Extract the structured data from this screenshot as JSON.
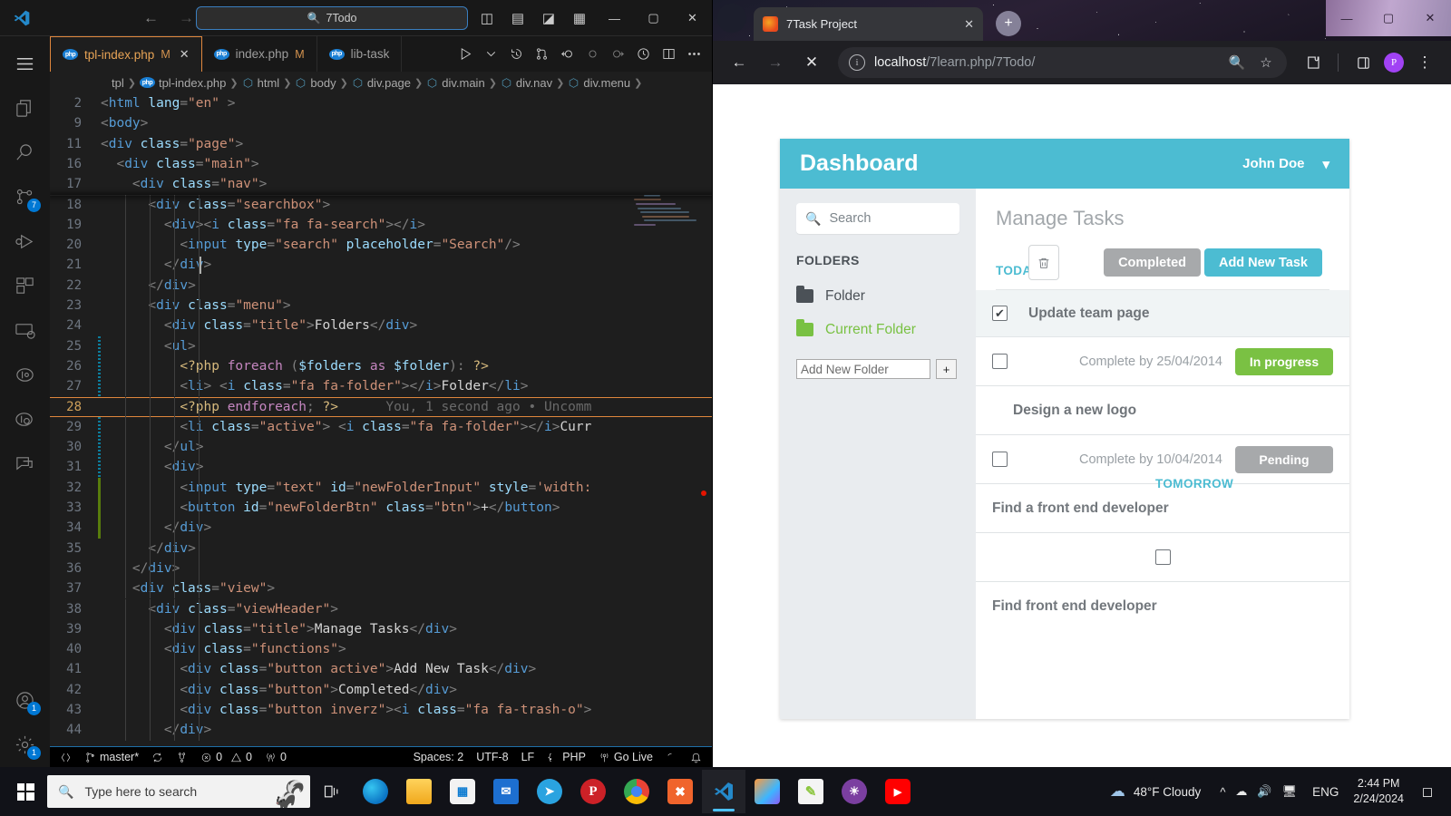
{
  "vscode": {
    "titlebar": {
      "search_text": "7Todo",
      "search_icon": "search-icon",
      "back_icon": "←",
      "forward_icon": "→",
      "layout_icons": [
        "panel-left-icon",
        "panel-bottom-icon",
        "panel-right-icon",
        "customize-layout-icon"
      ],
      "minimize": "—",
      "maximize": "▢",
      "close": "✕"
    },
    "activitybar": {
      "menu_icon": "hamburger-menu-icon",
      "items": [
        {
          "name": "explorer-icon",
          "badge": ""
        },
        {
          "name": "search-icon",
          "badge": ""
        },
        {
          "name": "source-control-icon",
          "badge": "7"
        },
        {
          "name": "run-debug-icon",
          "badge": ""
        },
        {
          "name": "extensions-icon",
          "badge": ""
        },
        {
          "name": "remote-explorer-icon",
          "badge": ""
        },
        {
          "name": "git-graph-icon",
          "badge": ""
        },
        {
          "name": "git-lens-icon",
          "badge": ""
        },
        {
          "name": "chat-icon",
          "badge": ""
        }
      ],
      "bottom_items": [
        {
          "name": "accounts-icon",
          "badge": "1"
        },
        {
          "name": "settings-gear-icon",
          "badge": "1"
        }
      ]
    },
    "tabs": [
      {
        "label": "tpl-index.php",
        "modified": "M",
        "active": true,
        "icon": "php-file-icon",
        "close": "✕"
      },
      {
        "label": "index.php",
        "modified": "M",
        "active": false,
        "icon": "php-file-icon",
        "close": ""
      },
      {
        "label": "lib-task",
        "modified": "",
        "active": false,
        "icon": "php-file-icon",
        "close": ""
      }
    ],
    "tab_actions": [
      "run-icon",
      "chevron-down-icon",
      "timeline-icon",
      "compare-icon",
      "go-back-icon",
      "circle-icon",
      "circle-arrow-icon",
      "clock-icon",
      "split-editor-icon",
      "more-actions-icon"
    ],
    "breadcrumb": [
      "tpl",
      "tpl-index.php",
      "html",
      "body",
      "div.page",
      "div.main",
      "div.nav",
      "div.menu"
    ],
    "code_lines": [
      {
        "num": "2",
        "sticky": true,
        "html": "<span class=\"t-punc\">&lt;</span><span class=\"t-tag\">html</span> <span class=\"t-attr\">lang</span><span class=\"t-punc\">=</span><span class=\"t-str\">\"en\"</span> <span class=\"t-punc\">&gt;</span>"
      },
      {
        "num": "9",
        "sticky": true,
        "html": "<span class=\"t-punc\">&lt;</span><span class=\"t-tag\">body</span><span class=\"t-punc\">&gt;</span>"
      },
      {
        "num": "11",
        "sticky": true,
        "html": "<span class=\"t-punc\">&lt;</span><span class=\"t-tag\">div</span> <span class=\"t-attr\">class</span><span class=\"t-punc\">=</span><span class=\"t-str\">\"page\"</span><span class=\"t-punc\">&gt;</span>"
      },
      {
        "num": "16",
        "sticky": true,
        "html": "  <span class=\"t-punc\">&lt;</span><span class=\"t-tag\">div</span> <span class=\"t-attr\">class</span><span class=\"t-punc\">=</span><span class=\"t-str\">\"main\"</span><span class=\"t-punc\">&gt;</span>"
      },
      {
        "num": "17",
        "sticky": true,
        "html": "    <span class=\"t-punc\">&lt;</span><span class=\"t-tag\">div</span> <span class=\"t-attr\">class</span><span class=\"t-punc\">=</span><span class=\"t-str\">\"nav\"</span><span class=\"t-punc\">&gt;</span>"
      },
      {
        "num": "18",
        "html": "      <span class=\"t-punc\">&lt;</span><span class=\"t-tag\">div</span> <span class=\"t-attr\">class</span><span class=\"t-punc\">=</span><span class=\"t-str\">\"searchbox\"</span><span class=\"t-punc\">&gt;</span>"
      },
      {
        "num": "19",
        "html": "        <span class=\"t-punc\">&lt;</span><span class=\"t-tag\">div</span><span class=\"t-punc\">&gt;&lt;</span><span class=\"t-tag\">i</span> <span class=\"t-attr\">class</span><span class=\"t-punc\">=</span><span class=\"t-str\">\"fa fa-search\"</span><span class=\"t-punc\">&gt;&lt;/</span><span class=\"t-tag\">i</span><span class=\"t-punc\">&gt;</span>"
      },
      {
        "num": "20",
        "html": "          <span class=\"t-punc\">&lt;</span><span class=\"t-tag\">input</span> <span class=\"t-attr\">type</span><span class=\"t-punc\">=</span><span class=\"t-str\">\"search\"</span> <span class=\"t-attr\">placeholder</span><span class=\"t-punc\">=</span><span class=\"t-str\">\"Search\"</span><span class=\"t-punc\">/&gt;</span>"
      },
      {
        "num": "21",
        "html": "        <span class=\"t-punc\">&lt;/</span><span class=\"t-tag\">div</span><span class=\"t-punc\">&gt;</span>"
      },
      {
        "num": "22",
        "html": "      <span class=\"t-punc\">&lt;/</span><span class=\"t-tag\">div</span><span class=\"t-punc\">&gt;</span>"
      },
      {
        "num": "23",
        "html": "      <span class=\"t-punc\">&lt;</span><span class=\"t-tag\">div</span> <span class=\"t-attr\">class</span><span class=\"t-punc\">=</span><span class=\"t-str\">\"menu\"</span><span class=\"t-punc\">&gt;</span>"
      },
      {
        "num": "24",
        "html": "        <span class=\"t-punc\">&lt;</span><span class=\"t-tag\">div</span> <span class=\"t-attr\">class</span><span class=\"t-punc\">=</span><span class=\"t-str\">\"title\"</span><span class=\"t-punc\">&gt;</span><span class=\"t-txt\">Folders</span><span class=\"t-punc\">&lt;/</span><span class=\"t-tag\">div</span><span class=\"t-punc\">&gt;</span>"
      },
      {
        "num": "25",
        "html": "        <span class=\"t-punc\">&lt;</span><span class=\"t-tag\">ul</span><span class=\"t-punc\">&gt;</span>"
      },
      {
        "num": "26",
        "html": "          <span class=\"t-dlm\">&lt;?php</span> <span class=\"t-kw\">foreach</span> <span class=\"t-punc\">(</span><span class=\"t-var\">$folders</span> <span class=\"t-kw\">as</span> <span class=\"t-var\">$folder</span><span class=\"t-punc\">):</span> <span class=\"t-dlm\">?&gt;</span>"
      },
      {
        "num": "27",
        "html": "          <span class=\"t-punc\">&lt;</span><span class=\"t-tag\">li</span><span class=\"t-punc\">&gt;</span> <span class=\"t-punc\">&lt;</span><span class=\"t-tag\">i</span> <span class=\"t-attr\">class</span><span class=\"t-punc\">=</span><span class=\"t-str\">\"fa fa-folder\"</span><span class=\"t-punc\">&gt;&lt;/</span><span class=\"t-tag\">i</span><span class=\"t-punc\">&gt;</span><span class=\"t-txt\">Folder</span><span class=\"t-punc\">&lt;/</span><span class=\"t-tag\">li</span><span class=\"t-punc\">&gt;</span>"
      },
      {
        "num": "28",
        "current": true,
        "html": "          <span class=\"t-dlm\">&lt;?php</span> <span class=\"t-kw\">endforeach</span><span class=\"t-punc\">;</span> <span class=\"t-dlm\">?&gt;</span>      <span class=\"t-blame\">You, 1 second ago • Uncomm</span>"
      },
      {
        "num": "29",
        "html": "          <span class=\"t-punc\">&lt;</span><span class=\"t-tag\">li</span> <span class=\"t-attr\">class</span><span class=\"t-punc\">=</span><span class=\"t-str\">\"active\"</span><span class=\"t-punc\">&gt;</span> <span class=\"t-punc\">&lt;</span><span class=\"t-tag\">i</span> <span class=\"t-attr\">class</span><span class=\"t-punc\">=</span><span class=\"t-str\">\"fa fa-folder\"</span><span class=\"t-punc\">&gt;&lt;/</span><span class=\"t-tag\">i</span><span class=\"t-punc\">&gt;</span><span class=\"t-txt\">Curr</span>"
      },
      {
        "num": "30",
        "html": "        <span class=\"t-punc\">&lt;/</span><span class=\"t-tag\">ul</span><span class=\"t-punc\">&gt;</span>"
      },
      {
        "num": "31",
        "html": "        <span class=\"t-punc\">&lt;</span><span class=\"t-tag\">div</span><span class=\"t-punc\">&gt;</span>"
      },
      {
        "num": "32",
        "html": "          <span class=\"t-punc\">&lt;</span><span class=\"t-tag\">input</span> <span class=\"t-attr\">type</span><span class=\"t-punc\">=</span><span class=\"t-str\">\"text\"</span> <span class=\"t-attr\">id</span><span class=\"t-punc\">=</span><span class=\"t-str\">\"newFolderInput\"</span> <span class=\"t-attr\">style</span><span class=\"t-punc\">=</span><span class=\"t-str\">'width:</span>"
      },
      {
        "num": "33",
        "html": "          <span class=\"t-punc\">&lt;</span><span class=\"t-tag\">button</span> <span class=\"t-attr\">id</span><span class=\"t-punc\">=</span><span class=\"t-str\">\"newFolderBtn\"</span> <span class=\"t-attr\">class</span><span class=\"t-punc\">=</span><span class=\"t-str\">\"btn\"</span><span class=\"t-punc\">&gt;</span><span class=\"t-txt\">+</span><span class=\"t-punc\">&lt;/</span><span class=\"t-tag\">button</span><span class=\"t-punc\">&gt;</span>"
      },
      {
        "num": "34",
        "html": "        <span class=\"t-punc\">&lt;/</span><span class=\"t-tag\">div</span><span class=\"t-punc\">&gt;</span>"
      },
      {
        "num": "35",
        "html": "      <span class=\"t-punc\">&lt;/</span><span class=\"t-tag\">div</span><span class=\"t-punc\">&gt;</span>"
      },
      {
        "num": "36",
        "html": "    <span class=\"t-punc\">&lt;/</span><span class=\"t-tag\">div</span><span class=\"t-punc\">&gt;</span>"
      },
      {
        "num": "37",
        "html": "    <span class=\"t-punc\">&lt;</span><span class=\"t-tag\">div</span> <span class=\"t-attr\">class</span><span class=\"t-punc\">=</span><span class=\"t-str\">\"view\"</span><span class=\"t-punc\">&gt;</span>"
      },
      {
        "num": "38",
        "html": "      <span class=\"t-punc\">&lt;</span><span class=\"t-tag\">div</span> <span class=\"t-attr\">class</span><span class=\"t-punc\">=</span><span class=\"t-str\">\"viewHeader\"</span><span class=\"t-punc\">&gt;</span>"
      },
      {
        "num": "39",
        "html": "        <span class=\"t-punc\">&lt;</span><span class=\"t-tag\">div</span> <span class=\"t-attr\">class</span><span class=\"t-punc\">=</span><span class=\"t-str\">\"title\"</span><span class=\"t-punc\">&gt;</span><span class=\"t-txt\">Manage Tasks</span><span class=\"t-punc\">&lt;/</span><span class=\"t-tag\">div</span><span class=\"t-punc\">&gt;</span>"
      },
      {
        "num": "40",
        "html": "        <span class=\"t-punc\">&lt;</span><span class=\"t-tag\">div</span> <span class=\"t-attr\">class</span><span class=\"t-punc\">=</span><span class=\"t-str\">\"functions\"</span><span class=\"t-punc\">&gt;</span>"
      },
      {
        "num": "41",
        "html": "          <span class=\"t-punc\">&lt;</span><span class=\"t-tag\">div</span> <span class=\"t-attr\">class</span><span class=\"t-punc\">=</span><span class=\"t-str\">\"button active\"</span><span class=\"t-punc\">&gt;</span><span class=\"t-txt\">Add New Task</span><span class=\"t-punc\">&lt;/</span><span class=\"t-tag\">div</span><span class=\"t-punc\">&gt;</span>"
      },
      {
        "num": "42",
        "html": "          <span class=\"t-punc\">&lt;</span><span class=\"t-tag\">div</span> <span class=\"t-attr\">class</span><span class=\"t-punc\">=</span><span class=\"t-str\">\"button\"</span><span class=\"t-punc\">&gt;</span><span class=\"t-txt\">Completed</span><span class=\"t-punc\">&lt;/</span><span class=\"t-tag\">div</span><span class=\"t-punc\">&gt;</span>"
      },
      {
        "num": "43",
        "html": "          <span class=\"t-punc\">&lt;</span><span class=\"t-tag\">div</span> <span class=\"t-attr\">class</span><span class=\"t-punc\">=</span><span class=\"t-str\">\"button inverz\"</span><span class=\"t-punc\">&gt;&lt;</span><span class=\"t-tag\">i</span> <span class=\"t-attr\">class</span><span class=\"t-punc\">=</span><span class=\"t-str\">\"fa fa-trash-o\"</span><span class=\"t-punc\">&gt;</span>"
      },
      {
        "num": "44",
        "html": "        <span class=\"t-punc\">&lt;/</span><span class=\"t-tag\">div</span><span class=\"t-punc\">&gt;</span>"
      }
    ],
    "statusbar": {
      "remote_icon": "remote-window-icon",
      "branch_icon": "git-branch-icon",
      "branch": "master*",
      "sync_icon": "sync-icon",
      "fork_icon": "git-fork-icon",
      "errors_icon": "error-icon",
      "errors": "0",
      "warnings_icon": "warning-icon",
      "warnings": "0",
      "ports_icon": "radio-tower-icon",
      "ports": "0",
      "spaces": "Spaces: 2",
      "encoding": "UTF-8",
      "eol": "LF",
      "language_icon": "braces-icon",
      "language": "PHP",
      "golive_icon": "broadcast-icon",
      "golive": "Go Live",
      "spinner_icon": "loading-spinner-icon",
      "bell_icon": "bell-icon"
    }
  },
  "browser": {
    "tab_chevron_icon": "chevron-down-icon",
    "tab": {
      "favicon": "site-favicon",
      "title": "7Task Project",
      "close_icon": "close-icon"
    },
    "new_tab_icon": "+",
    "window_controls": {
      "minimize": "—",
      "maximize": "▢",
      "close": "✕"
    },
    "toolbar": {
      "back_icon": "←",
      "forward_icon": "→",
      "stop_icon": "✕",
      "site_info_icon": "info-circle-icon",
      "url_host": "localhost",
      "url_path": "/7learn.php/7Todo/",
      "zoom_icon": "search-glass-icon",
      "bookmark_icon": "star-icon",
      "extensions_icon": "puzzle-icon",
      "sidepanel_icon": "side-panel-icon",
      "profile_initial": "P",
      "menu_icon": "three-dots-menu-icon"
    }
  },
  "app": {
    "header": {
      "title": "Dashboard",
      "user": "John Doe",
      "chevron_icon": "chevron-down-icon"
    },
    "nav": {
      "search_icon": "search-icon",
      "search_placeholder": "Search",
      "search_value": "",
      "menu_title": "FOLDERS",
      "folders": [
        {
          "label": "Folder",
          "active": false,
          "icon": "folder-icon"
        },
        {
          "label": "Current Folder",
          "active": true,
          "icon": "folder-icon"
        }
      ],
      "new_folder_placeholder": "Add New Folder",
      "new_folder_value": "",
      "new_folder_button": "+"
    },
    "view": {
      "title": "Manage Tasks",
      "buttons": {
        "add_new_task": "Add New Task",
        "completed": "Completed",
        "trash_icon": "trash-icon"
      },
      "day_today": "TODAY",
      "day_tomorrow": "TOMORROW",
      "tasks": [
        {
          "name": "Update team page",
          "checked": true,
          "check_icon": "checked-box-icon",
          "due": "",
          "status": "",
          "status_color": ""
        },
        {
          "name": "",
          "checked": false,
          "check_icon": "empty-box-icon",
          "due": "Complete by 25/04/2014",
          "status": "In progress",
          "status_color": "#7ac143"
        },
        {
          "name": "Design a new logo",
          "checked": null,
          "check_icon": "",
          "due": "",
          "status": "",
          "status_color": ""
        },
        {
          "name": "",
          "checked": false,
          "check_icon": "empty-box-icon",
          "due": "Complete by 10/04/2014",
          "status": "Pending",
          "status_color": "#a7a9ab"
        },
        {
          "name": "Find a front end developer",
          "checked": null,
          "check_icon": "",
          "due": "",
          "status": "",
          "status_color": ""
        },
        {
          "name": "",
          "checked": false,
          "check_icon": "empty-box-icon",
          "due": "",
          "status": "",
          "status_color": ""
        },
        {
          "name": "Find front end developer",
          "checked": null,
          "check_icon": "",
          "due": "",
          "status": "",
          "status_color": ""
        }
      ]
    }
  },
  "taskbar": {
    "start_icon": "windows-start-icon",
    "search_icon": "search-icon",
    "search_placeholder": "Type here to search",
    "mascot_icon": "monkey-icon",
    "taskview_icon": "task-view-icon",
    "pinned": [
      {
        "name": "edge-icon",
        "glyph": "e",
        "color": "#0f7dc2"
      },
      {
        "name": "file-explorer-icon",
        "glyph": "",
        "color": "#f5b81c"
      },
      {
        "name": "microsoft-store-icon",
        "glyph": "",
        "color": "#f2f2f2"
      },
      {
        "name": "mail-icon",
        "glyph": "",
        "color": "#1d6fd0"
      },
      {
        "name": "telegram-icon",
        "glyph": "",
        "color": "#2aa3e0"
      },
      {
        "name": "pinterest-icon",
        "glyph": "P",
        "color": "#cc2127"
      },
      {
        "name": "chrome-icon",
        "glyph": "",
        "color": "#ffffff"
      },
      {
        "name": "xampp-icon",
        "glyph": "",
        "color": "#f0642c"
      },
      {
        "name": "vscode-icon",
        "glyph": "",
        "color": "#2489ca"
      },
      {
        "name": "sublime-icon",
        "glyph": "",
        "color": "#ea9d31"
      },
      {
        "name": "notepad-icon",
        "glyph": "",
        "color": "#8cc63f"
      },
      {
        "name": "photos-icon",
        "glyph": "",
        "color": "#7b3fa0"
      },
      {
        "name": "youtube-icon",
        "glyph": "▶",
        "color": "#ff0000"
      }
    ],
    "weather_icon": "cloud-icon",
    "weather": "48°F  Cloudy",
    "tray": {
      "chevron_icon": "show-hidden-icons-icon",
      "onedrive_icon": "onedrive-icon",
      "volume_icon": "volume-icon",
      "network_icon": "network-icon",
      "language": "ENG"
    },
    "time": "2:44 PM",
    "date": "2/24/2024",
    "notification_icon": "notification-icon"
  }
}
